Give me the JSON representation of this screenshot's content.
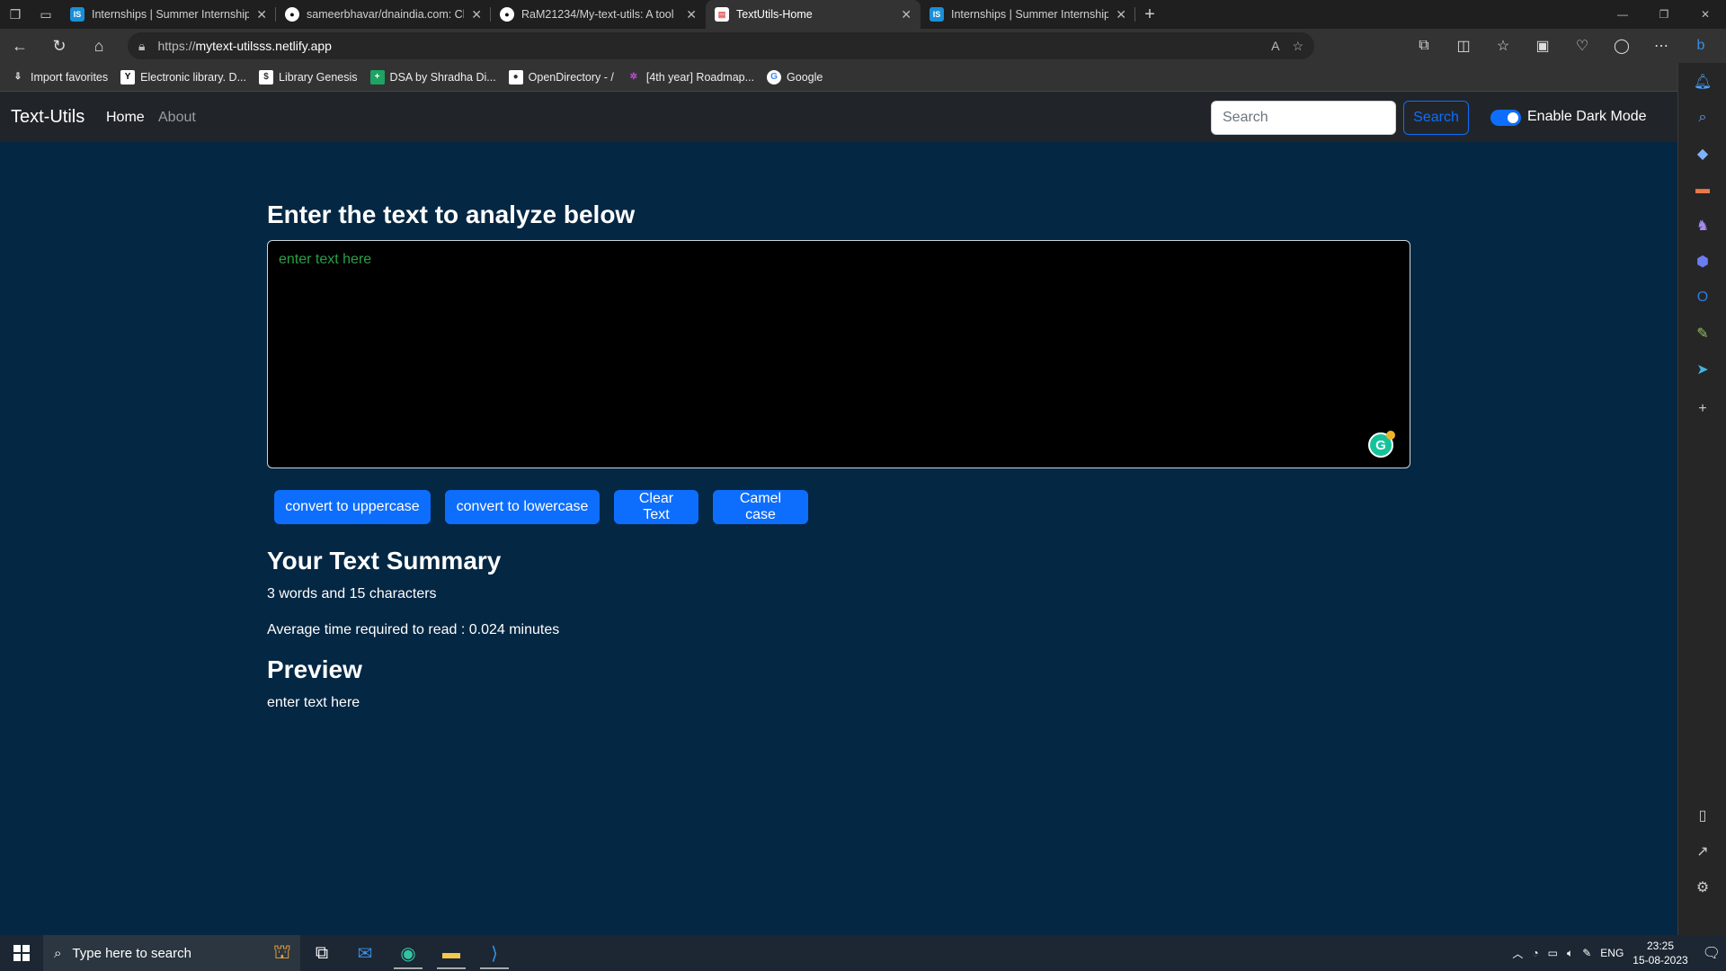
{
  "browser": {
    "tabs": [
      {
        "title": "Internships | Summer Internship",
        "favicon": "IS",
        "favicon_color": "#1a8fd9"
      },
      {
        "title": "sameerbhavar/dnaindia.com: Clo",
        "favicon": "github",
        "favicon_color": "#ffffff"
      },
      {
        "title": "RaM21234/My-text-utils: A tool",
        "favicon": "github",
        "favicon_color": "#ffffff"
      },
      {
        "title": "TextUtils-Home",
        "favicon": "page",
        "favicon_color": "#e25555"
      },
      {
        "title": "Internships | Summer Internship",
        "favicon": "IS",
        "favicon_color": "#1a8fd9"
      }
    ],
    "active_tab_index": 3,
    "url_prefix": "https://",
    "url_host": "mytext-utilsss.netlify.app",
    "favorites": [
      {
        "label": "Import favorites",
        "icon": "import-icon"
      },
      {
        "label": "Electronic library. D...",
        "icon": "y-icon"
      },
      {
        "label": "Library Genesis",
        "icon": "book-icon"
      },
      {
        "label": "DSA by Shradha Di...",
        "icon": "plus-icon"
      },
      {
        "label": "OpenDirectory - /",
        "icon": "folder-icon"
      },
      {
        "label": "[4th year] Roadmap...",
        "icon": "roadmap-icon"
      },
      {
        "label": "Google",
        "icon": "google-icon"
      }
    ]
  },
  "page": {
    "brand": "Text-Utils",
    "nav": {
      "home": "Home",
      "about": "About"
    },
    "search_placeholder": "Search",
    "search_button": "Search",
    "dark_mode_label": "Enable Dark Mode",
    "heading": "Enter the text to analyze below",
    "textarea_placeholder": "enter text here",
    "buttons": {
      "uppercase": "convert to uppercase",
      "lowercase": "convert to lowercase",
      "clear": "Clear Text",
      "camel": "Camel case"
    },
    "summary_title": "Your Text Summary",
    "summary_counts": "3 words and 15 characters",
    "summary_read_time": "Average time required to read : 0.024 minutes",
    "preview_title": "Preview",
    "preview_text": "enter text here"
  },
  "taskbar": {
    "search_placeholder": "Type here to search",
    "language": "ENG",
    "time": "23:25",
    "date": "15-08-2023"
  },
  "colors": {
    "page_bg": "#042743",
    "navbar_bg": "#212529",
    "primary": "#0d6efd"
  }
}
